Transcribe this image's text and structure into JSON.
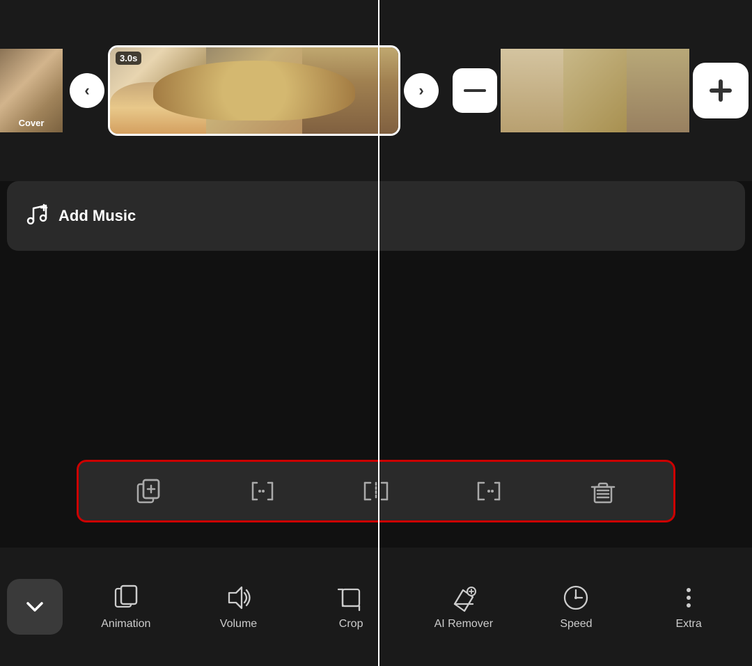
{
  "timeline": {
    "cover_label": "Cover",
    "clip_duration": "3.0s",
    "left_arrow": "‹",
    "right_arrow": "›",
    "minus_symbol": "−",
    "plus_symbol": "+"
  },
  "music": {
    "label": "Add Music",
    "icon": "music-add-icon"
  },
  "toolbar": {
    "icons": [
      {
        "id": "copy-add-icon",
        "tooltip": "Copy and Add"
      },
      {
        "id": "split-left-icon",
        "tooltip": "Split Left"
      },
      {
        "id": "split-center-icon",
        "tooltip": "Split Center"
      },
      {
        "id": "split-right-icon",
        "tooltip": "Split Right"
      },
      {
        "id": "delete-icon",
        "tooltip": "Delete"
      }
    ]
  },
  "bottom_nav": {
    "close_icon": "chevron-down-icon",
    "items": [
      {
        "id": "animation",
        "label": "Animation",
        "icon": "animation-icon"
      },
      {
        "id": "volume",
        "label": "Volume",
        "icon": "volume-icon"
      },
      {
        "id": "crop",
        "label": "Crop",
        "icon": "crop-icon"
      },
      {
        "id": "ai-remover",
        "label": "AI Remover",
        "icon": "ai-remover-icon"
      },
      {
        "id": "speed",
        "label": "Speed",
        "icon": "speed-icon"
      },
      {
        "id": "extra",
        "label": "Extra",
        "icon": "extra-icon"
      }
    ]
  }
}
